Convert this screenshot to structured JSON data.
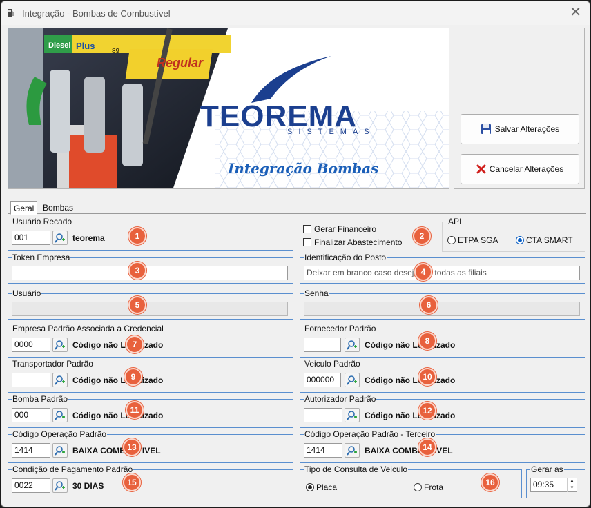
{
  "window": {
    "title": "Integração - Bombas de Combustível"
  },
  "banner": {
    "logo_name": "TEOREMA",
    "logo_sub": "SISTEMAS",
    "caption": "Integração Bombas",
    "pump_labels": [
      "Diesel",
      "Plus",
      "89",
      "Regular"
    ]
  },
  "actions": {
    "save_label": "Salvar Alterações",
    "cancel_label": "Cancelar Alterações"
  },
  "tabs": [
    {
      "label": "Geral"
    },
    {
      "label": "Bombas"
    }
  ],
  "fields": {
    "usuario_recado": {
      "label": "Usuário Recado",
      "code": "001",
      "desc": "teorema",
      "badge": "1"
    },
    "gerar_financeiro": {
      "label": "Gerar Financeiro"
    },
    "finalizar_abastecimento": {
      "label": "Finalizar Abastecimento"
    },
    "opts_badge": "2",
    "api": {
      "label": "API",
      "opt1": "ETPA SGA",
      "opt2": "CTA SMART",
      "selected": "CTA SMART"
    },
    "token_empresa": {
      "label": "Token Empresa",
      "value": "",
      "badge": "3"
    },
    "identificacao_posto": {
      "label": "Identificação do Posto",
      "placeholder": "Deixar em branco caso deseje ver todas as filiais",
      "badge": "4"
    },
    "usuario": {
      "label": "Usuário",
      "value": "",
      "badge": "5"
    },
    "senha": {
      "label": "Senha",
      "value": "",
      "badge": "6"
    },
    "empresa_padrao": {
      "label": "Empresa Padrão Associada a Credencial",
      "code": "0000",
      "desc": "Código não Localizado",
      "badge": "7"
    },
    "fornecedor_padrao": {
      "label": "Fornecedor Padrão",
      "code": "",
      "desc": "Código não Localizado",
      "badge": "8"
    },
    "transportador_padrao": {
      "label": "Transportador Padrão",
      "code": "",
      "desc": "Código não Localizado",
      "badge": "9"
    },
    "veiculo_padrao": {
      "label": "Veiculo Padrão",
      "code": "000000",
      "desc": "Código não Localizado",
      "badge": "10"
    },
    "bomba_padrao": {
      "label": "Bomba Padrão",
      "code": "000",
      "desc": "Código não Localizado",
      "badge": "11"
    },
    "autorizador_padrao": {
      "label": "Autorizador Padrão",
      "code": "",
      "desc": "Código não Localizado",
      "badge": "12"
    },
    "codigo_operacao": {
      "label": "Código Operação Padrão",
      "code": "1414",
      "desc": "BAIXA COMBUSTIVEL",
      "badge": "13"
    },
    "codigo_operacao_terceiro": {
      "label": "Código Operação Padrão - Terceiro",
      "code": "1414",
      "desc": "BAIXA COMBUSTIVEL",
      "badge": "14"
    },
    "condicao_pagamento": {
      "label": "Condição de Pagamento Padrão",
      "code": "0022",
      "desc": "30 DIAS",
      "badge": "15"
    },
    "tipo_consulta": {
      "label": "Tipo de Consulta de Veiculo",
      "opt1": "Placa",
      "opt2": "Frota",
      "selected": "Placa",
      "badge": "16"
    },
    "gerar_as": {
      "label": "Gerar as",
      "value": "09:35"
    }
  },
  "colors": {
    "accent": "#0b5fc4",
    "group_border": "#5a8fcf",
    "badge": "#e8613d",
    "logo_blue": "#1b3f8f"
  }
}
